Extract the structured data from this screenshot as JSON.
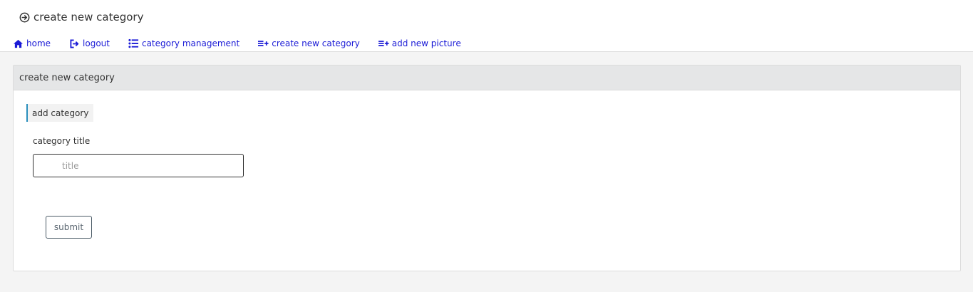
{
  "header": {
    "title": "create new category",
    "title_icon": "arrow-circle-right-icon"
  },
  "nav": {
    "items": [
      {
        "label": "home",
        "icon": "home-icon"
      },
      {
        "label": "logout",
        "icon": "logout-icon"
      },
      {
        "label": "category management",
        "icon": "list-icon"
      },
      {
        "label": "create new category",
        "icon": "list-add-icon"
      },
      {
        "label": "add new picture",
        "icon": "list-add-icon"
      }
    ],
    "link_color": "#1a1ad6"
  },
  "panel": {
    "title": "create new category",
    "section_label": "add category",
    "field_label": "category title",
    "input_placeholder": "title",
    "input_value": "",
    "submit_label": "submit"
  }
}
